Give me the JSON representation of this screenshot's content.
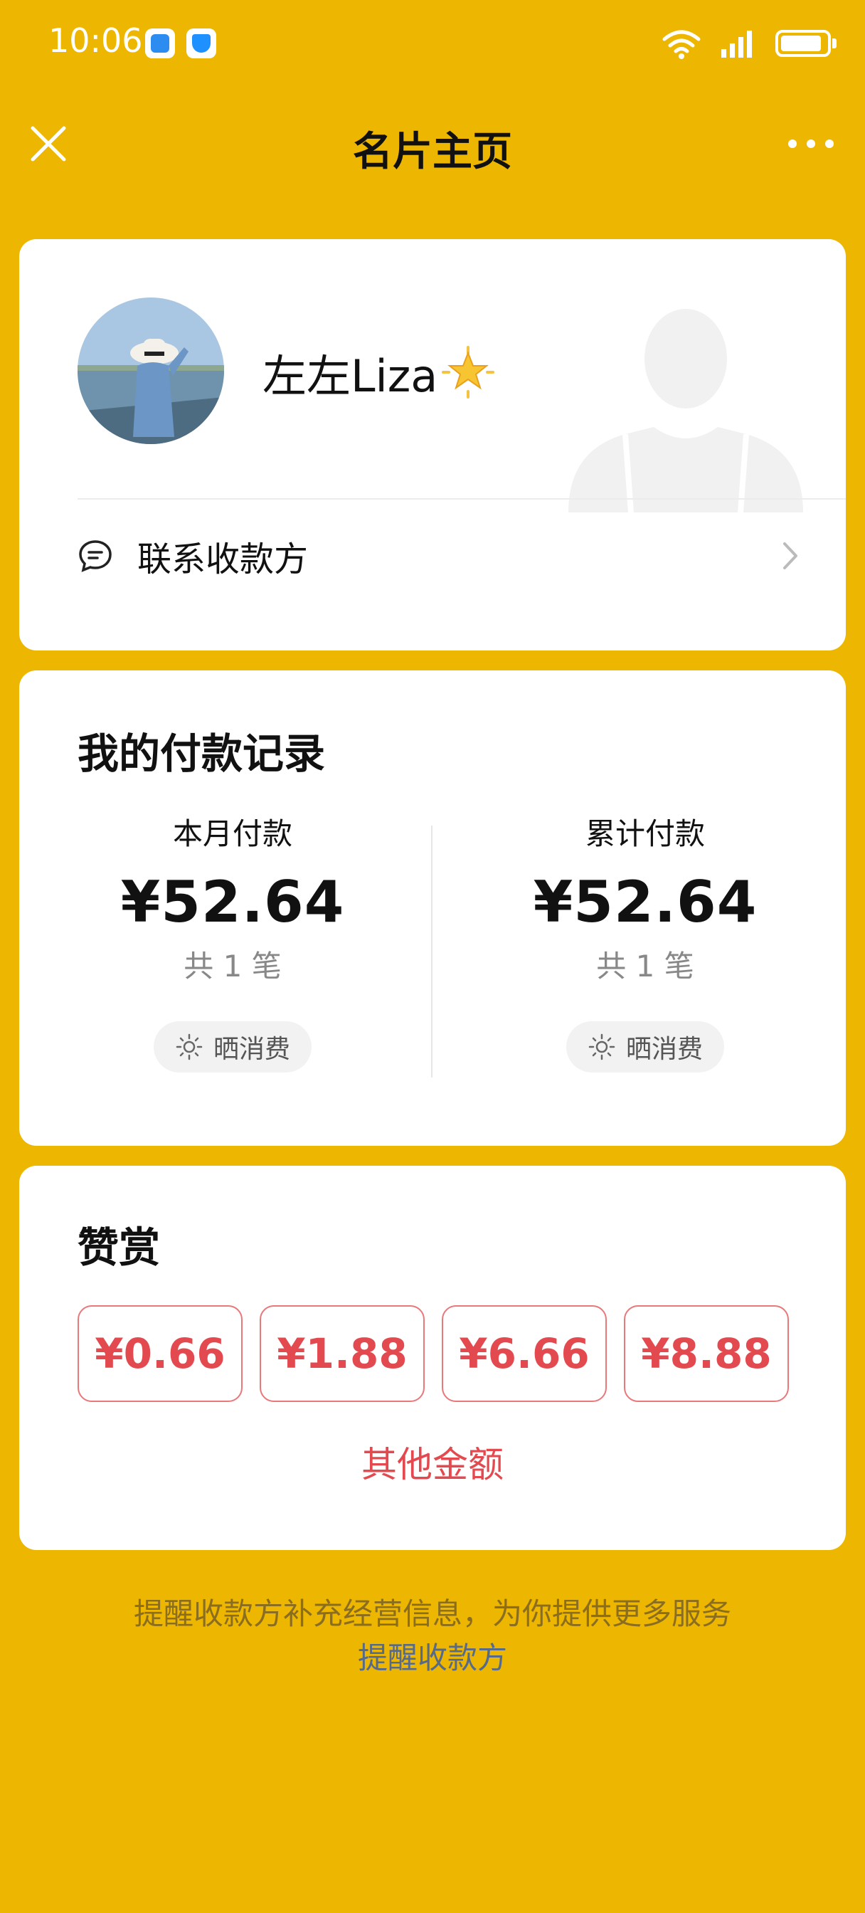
{
  "status_bar": {
    "time": "10:06",
    "battery_level": 0.9
  },
  "header": {
    "title": "名片主页"
  },
  "profile": {
    "name": "左左Liza",
    "contact_label": "联系收款方"
  },
  "payments": {
    "title": "我的付款记录",
    "monthly": {
      "label": "本月付款",
      "amount": "¥52.64",
      "count": "共 1 笔",
      "share_label": "晒消费"
    },
    "total": {
      "label": "累计付款",
      "amount": "¥52.64",
      "count": "共 1 笔",
      "share_label": "晒消费"
    }
  },
  "tips": {
    "title": "赞赏",
    "amounts": [
      "¥0.66",
      "¥1.88",
      "¥6.66",
      "¥8.88"
    ],
    "other_label": "其他金额"
  },
  "footer": {
    "note": "提醒收款方补充经营信息，为你提供更多服务",
    "link": "提醒收款方"
  },
  "colors": {
    "background": "#EDB600",
    "accent_red": "#E34A4F",
    "link_blue": "#566A8C"
  }
}
